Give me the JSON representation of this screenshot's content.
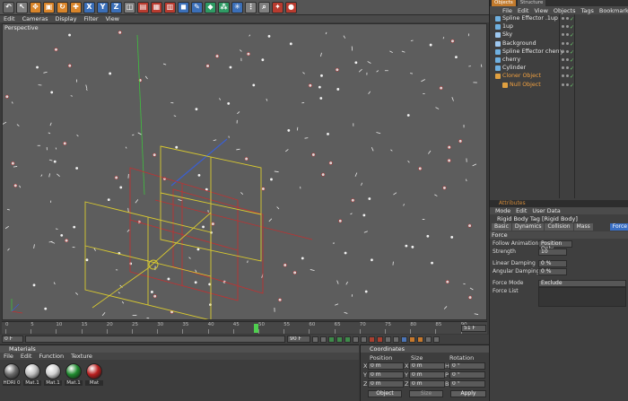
{
  "toolbar": {
    "icons": [
      "undo-icon",
      "select-icon",
      "move-icon",
      "scale-icon",
      "rotate-icon",
      "add-icon",
      "x-axis-icon",
      "y-axis-icon",
      "z-axis-icon",
      "world-icon",
      "render-view-icon",
      "render-icon",
      "render-settings-icon",
      "cube-icon",
      "spline-pen-icon",
      "nurbs-icon",
      "array-icon",
      "deformer-icon",
      "scene-icon",
      "camera-icon",
      "light-icon",
      "tag-icon"
    ],
    "axis_x": "X",
    "axis_y": "Y",
    "axis_z": "Z"
  },
  "viewport": {
    "menu": [
      "Edit",
      "Cameras",
      "Display",
      "Filter",
      "View"
    ],
    "title": "Perspective"
  },
  "timeline": {
    "ticks": [
      "0",
      "5",
      "10",
      "15",
      "20",
      "25",
      "30",
      "35",
      "40",
      "45",
      "50",
      "55",
      "60",
      "65",
      "70",
      "75",
      "80",
      "85",
      "90"
    ],
    "end_label": "51 F"
  },
  "transport": {
    "start": "0 F",
    "current": "0 F",
    "end": "90 F"
  },
  "materials": {
    "title": "Materials",
    "menu": [
      "File",
      "Edit",
      "Function",
      "Texture"
    ],
    "items": [
      {
        "label": "HDRI 0",
        "color": "#6a6a6a"
      },
      {
        "label": "Mat.1",
        "color": "#bdbdbd"
      },
      {
        "label": "Mat.1",
        "color": "#d0d0d0"
      },
      {
        "label": "Mat.1",
        "color": "#1f8a2e"
      },
      {
        "label": "Mat",
        "color": "#b81f1f"
      }
    ]
  },
  "coordinates": {
    "title": "Coordinates",
    "columns": [
      "Position",
      "Size",
      "Rotation"
    ],
    "rows": [
      {
        "axis": "X",
        "pos": "0 m",
        "size_axis": "X",
        "size": "0 m",
        "rot_axis": "H",
        "rot": "0 °"
      },
      {
        "axis": "Y",
        "pos": "0 m",
        "size_axis": "Y",
        "size": "0 m",
        "rot_axis": "P",
        "rot": "0 °"
      },
      {
        "axis": "Z",
        "pos": "0 m",
        "size_axis": "Z",
        "size": "0 m",
        "rot_axis": "B",
        "rot": "0 °"
      }
    ],
    "mode": "Object",
    "size_mode": "Size",
    "apply": "Apply"
  },
  "object_manager": {
    "tabs": [
      "Objects",
      "Structure"
    ],
    "menu": [
      "File",
      "Edit",
      "View",
      "Objects",
      "Tags",
      "Bookmarks"
    ],
    "objects": [
      {
        "name": "Spline Effector .1up",
        "color": "#6fb0e0",
        "indent": 0
      },
      {
        "name": "1up",
        "color": "#6fb0e0",
        "indent": 0
      },
      {
        "name": "Sky",
        "color": "#9ec8f0",
        "indent": 0
      },
      {
        "name": "Background",
        "color": "#9ec8f0",
        "indent": 0
      },
      {
        "name": "Spline Effector cherry",
        "color": "#6fb0e0",
        "indent": 0
      },
      {
        "name": "cherry",
        "color": "#6fb0e0",
        "indent": 0
      },
      {
        "name": "Cylinder",
        "color": "#6fb0e0",
        "indent": 0
      },
      {
        "name": "Cloner Object",
        "color": "#e0a040",
        "indent": 0,
        "highlight": true
      },
      {
        "name": "Null Object",
        "color": "#e0a040",
        "indent": 8,
        "highlight": true
      }
    ]
  },
  "attributes": {
    "title": "Attributes",
    "menu": [
      "Mode",
      "Edit",
      "User Data"
    ],
    "tag": "Rigid Body Tag [Rigid Body]",
    "tabs": [
      "Basic",
      "Dynamics",
      "Collision",
      "Mass",
      "Force"
    ],
    "active_tab": "Force",
    "section": "Force",
    "fields": [
      {
        "label": "Follow Animation",
        "value": "Position Only"
      },
      {
        "label": "Strength",
        "value": "10"
      },
      {
        "label": "Linear Damping",
        "value": "0 %"
      },
      {
        "label": "Angular Damping",
        "value": "0 %"
      },
      {
        "label": "Force Mode",
        "value": "Exclude"
      },
      {
        "label": "Force List",
        "value": ""
      }
    ]
  }
}
